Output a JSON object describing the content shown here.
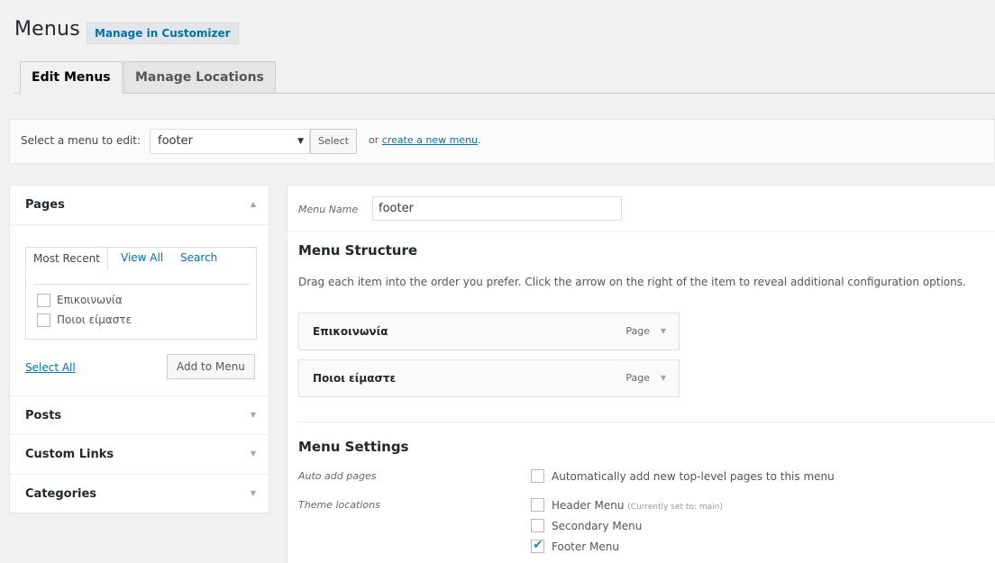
{
  "header": {
    "title": "Menus",
    "customizer_button": "Manage in Customizer"
  },
  "tabs": [
    {
      "label": "Edit Menus",
      "active": true
    },
    {
      "label": "Manage Locations",
      "active": false
    }
  ],
  "manage_bar": {
    "label": "Select a menu to edit:",
    "selected_menu": "footer",
    "select_button": "Select",
    "or_text": "or",
    "create_link": "create a new menu",
    "period": "."
  },
  "left_panel": {
    "sections": [
      {
        "title": "Pages",
        "expanded": true
      },
      {
        "title": "Posts",
        "expanded": false
      },
      {
        "title": "Custom Links",
        "expanded": false
      },
      {
        "title": "Categories",
        "expanded": false
      }
    ],
    "pages_tabs": [
      "Most Recent",
      "View All",
      "Search"
    ],
    "pages": [
      {
        "label": "Επικοινωνία",
        "checked": false
      },
      {
        "label": "Ποιοι είμαστε",
        "checked": false
      }
    ],
    "select_all": "Select All",
    "add_to_menu": "Add to Menu"
  },
  "right_panel": {
    "menu_name_label": "Menu Name",
    "menu_name_value": "footer",
    "structure_title": "Menu Structure",
    "structure_description": "Drag each item into the order you prefer. Click the arrow on the right of the item to reveal additional configuration options.",
    "items": [
      {
        "title": "Επικοινωνία",
        "type": "Page"
      },
      {
        "title": "Ποιοι είμαστε",
        "type": "Page"
      }
    ],
    "settings_title": "Menu Settings",
    "auto_add_label": "Auto add pages",
    "auto_add_option": "Automatically add new top-level pages to this menu",
    "auto_add_checked": false,
    "theme_locations_label": "Theme locations",
    "locations": [
      {
        "label": "Header Menu",
        "note": "(Currently set to: main)",
        "checked": false
      },
      {
        "label": "Secondary Menu",
        "note": "",
        "checked": false
      },
      {
        "label": "Footer Menu",
        "note": "",
        "checked": true
      }
    ]
  },
  "icons": {
    "expanded_arrow": "triangle-up-icon",
    "collapsed_arrow": "triangle-down-icon",
    "select_caret": "caret-down-icon",
    "checkmark": "checkmark-icon"
  },
  "colors": {
    "link": "#0073aa",
    "check": "#1e8cbe",
    "background": "#f1f1f1"
  }
}
